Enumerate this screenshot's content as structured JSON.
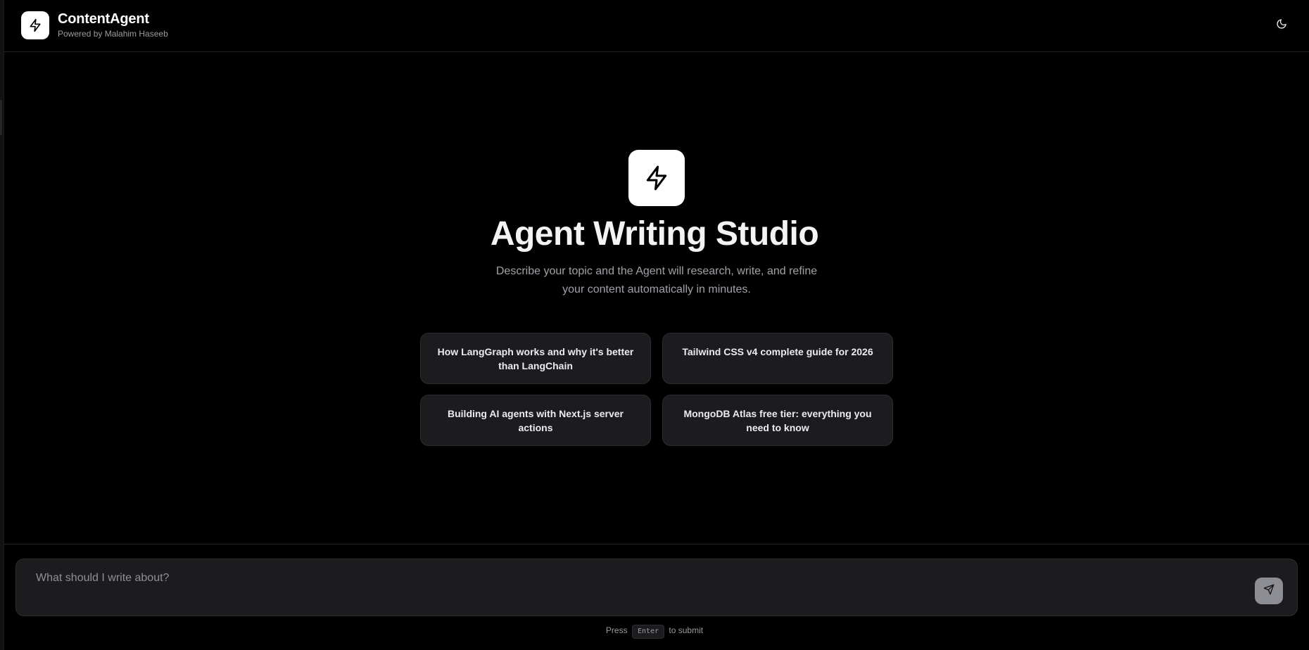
{
  "header": {
    "title": "ContentAgent",
    "subtitle": "Powered by Malahim Haseeb",
    "logo_icon": "lightning-icon",
    "theme_icon": "moon-icon"
  },
  "hero": {
    "icon": "lightning-icon",
    "title": "Agent Writing Studio",
    "description": "Describe your topic and the Agent will research, write, and refine your content automatically in minutes."
  },
  "suggestions": [
    "How LangGraph works and why it's better than LangChain",
    "Tailwind CSS v4 complete guide for 2026",
    "Building AI agents with Next.js server actions",
    "MongoDB Atlas free tier: everything you need to know"
  ],
  "composer": {
    "placeholder": "What should I write about?",
    "value": "",
    "send_icon": "send-icon"
  },
  "hint": {
    "prefix": "Press",
    "key": "Enter",
    "suffix": "to submit"
  },
  "colors": {
    "background": "#000000",
    "card": "#1c1c1f",
    "border": "#2c2d31",
    "send_button": "#8d8e93"
  }
}
